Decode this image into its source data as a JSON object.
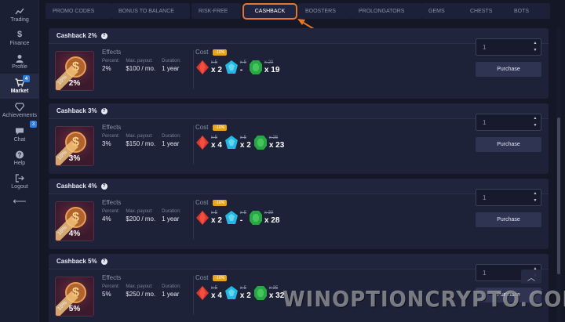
{
  "sidebar": {
    "items": [
      {
        "label": "Trading",
        "icon": "chart-icon"
      },
      {
        "label": "Finance",
        "icon": "dollar-icon"
      },
      {
        "label": "Profile",
        "icon": "user-icon"
      },
      {
        "label": "Market",
        "icon": "cart-icon",
        "badge": "4",
        "active": true
      },
      {
        "label": "Achievements",
        "icon": "diamond-icon"
      },
      {
        "label": "Chat",
        "icon": "chat-icon",
        "badge": "3"
      },
      {
        "label": "Help",
        "icon": "help-icon"
      },
      {
        "label": "Logout",
        "icon": "logout-icon"
      }
    ],
    "collapse_arrow": "⟵"
  },
  "tabs": [
    {
      "label": "PROMO CODES"
    },
    {
      "label": "BONUS TO BALANCE"
    },
    {
      "label": "RISK-FREE"
    },
    {
      "label": "CASHBACK",
      "active": true
    },
    {
      "label": "BOOSTERS"
    },
    {
      "label": "PROLONGATORS"
    },
    {
      "label": "GEMS"
    },
    {
      "label": "CHESTS"
    },
    {
      "label": "BOTS"
    }
  ],
  "labels": {
    "effects": "Effects",
    "percent": "Percent:",
    "max_payout": "Max. payout:",
    "duration": "Duration:",
    "cost": "Cost",
    "discount": "-10%",
    "purchase": "Purchase",
    "ribbon": "10%"
  },
  "cards": [
    {
      "title": "Cashback 2%",
      "thumb_pct": "2%",
      "percent": "2%",
      "max_payout": "$100 / mo.",
      "duration": "1 year",
      "gems": [
        {
          "color": "red",
          "old": "x 5",
          "qty": "x 2"
        },
        {
          "color": "blue",
          "old": "x 5",
          "qty": "-"
        },
        {
          "color": "green",
          "old": "x 20",
          "qty": "x 19"
        }
      ],
      "quantity": "1"
    },
    {
      "title": "Cashback 3%",
      "thumb_pct": "3%",
      "percent": "3%",
      "max_payout": "$150 / mo.",
      "duration": "1 year",
      "gems": [
        {
          "color": "red",
          "old": "x 5",
          "qty": "x 4"
        },
        {
          "color": "blue",
          "old": "x 5",
          "qty": "x 2"
        },
        {
          "color": "green",
          "old": "x 25",
          "qty": "x 23"
        }
      ],
      "quantity": "1"
    },
    {
      "title": "Cashback 4%",
      "thumb_pct": "4%",
      "percent": "4%",
      "max_payout": "$200 / mo.",
      "duration": "1 year",
      "gems": [
        {
          "color": "red",
          "old": "x 5",
          "qty": "x 2"
        },
        {
          "color": "blue",
          "old": "x 5",
          "qty": "-"
        },
        {
          "color": "green",
          "old": "x 30",
          "qty": "x 28"
        }
      ],
      "quantity": "1"
    },
    {
      "title": "Cashback 5%",
      "thumb_pct": "5%",
      "percent": "5%",
      "max_payout": "$250 / mo.",
      "duration": "1 year",
      "gems": [
        {
          "color": "red",
          "old": "x 5",
          "qty": "x 4"
        },
        {
          "color": "blue",
          "old": "x 5",
          "qty": "x 2"
        },
        {
          "color": "green",
          "old": "x 35",
          "qty": "x 32"
        }
      ],
      "quantity": "1"
    }
  ],
  "colors": {
    "accent": "#e5762a",
    "gem_red": "#e0352c",
    "gem_blue": "#23b8e0",
    "gem_green": "#28a844"
  },
  "watermark": "WINOPTIONCRYPTO.COM"
}
